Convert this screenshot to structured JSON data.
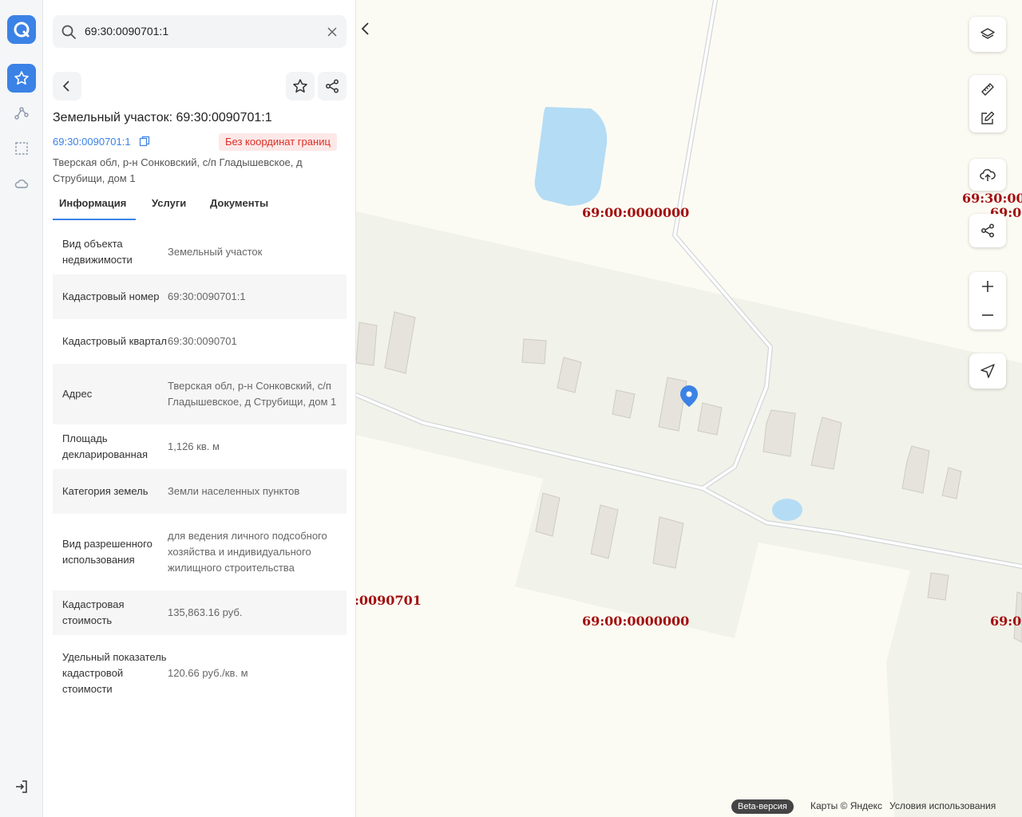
{
  "search": {
    "value": "69:30:0090701:1"
  },
  "object": {
    "title": "Земельный участок: 69:30:0090701:1",
    "cadastral_link": "69:30:0090701:1",
    "badge": "Без координат границ",
    "address": "Тверская обл, р-н Сонковский, с/п Гладышевское, д Струбищи, дом 1"
  },
  "tabs": [
    {
      "label": "Информация",
      "active": true
    },
    {
      "label": "Услуги"
    },
    {
      "label": "Документы"
    }
  ],
  "info_rows": [
    {
      "key": "Вид объекта недвижимости",
      "value": "Земельный участок"
    },
    {
      "key": "Кадастровый номер",
      "value": "69:30:0090701:1"
    },
    {
      "key": "Кадастровый квартал",
      "value": "69:30:0090701"
    },
    {
      "key": "Адрес",
      "value": "Тверская обл, р-н Сонковский, с/п Гладышевское, д Струбищи, дом 1"
    },
    {
      "key": "Площадь декларированная",
      "value": "1,126 кв. м"
    },
    {
      "key": "Категория земель",
      "value": "Земли населенных пунктов"
    },
    {
      "key": "Вид разрешенного использования",
      "value": "для ведения личного подсобного хозяйства и индивидуального жилищного строительства"
    },
    {
      "key": "Кадастровая стоимость",
      "value": "135,863.16 руб."
    },
    {
      "key": "Удельный показатель кадастровой стоимости",
      "value": "120.66 руб./кв. м"
    }
  ],
  "map": {
    "labels": {
      "top_center": "69:00:0000000",
      "right_top": "69:30:00",
      "right_top2": "69:0",
      "left_bottom": ":0090701",
      "bottom_center": "69:00:0000000",
      "right_bottom": "69:0"
    },
    "footer": {
      "beta": "Beta-версия",
      "copyright": "Карты © Яндекс",
      "terms": "Условия использования"
    }
  },
  "colors": {
    "accent": "#3b82e6",
    "badge_text": "#d93025",
    "label": "#a30f0f",
    "water": "#b4dcf5"
  }
}
